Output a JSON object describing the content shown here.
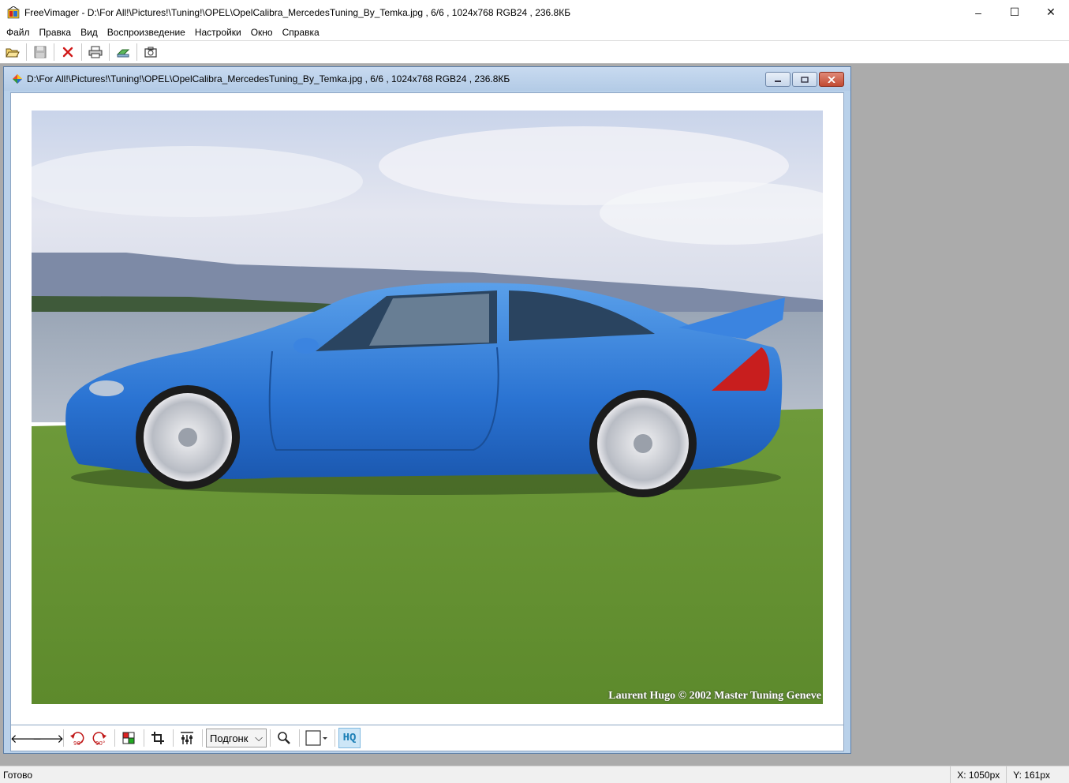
{
  "app": {
    "title": "FreeVimager - D:\\For All!\\Pictures!\\Tuning!\\OPEL\\OpelCalibra_MercedesTuning_By_Temka.jpg , 6/6 , 1024x768 RGB24 , 236.8КБ",
    "window_controls": {
      "minimize": "–",
      "maximize": "☐",
      "close": "✕"
    }
  },
  "menu": {
    "items": [
      "Файл",
      "Правка",
      "Вид",
      "Воспроизведение",
      "Настройки",
      "Окно",
      "Справка"
    ]
  },
  "toolbar": {
    "icons": [
      "open-folder-icon",
      "save-disk-icon",
      "delete-icon",
      "print-icon",
      "scan-icon",
      "camera-icon"
    ]
  },
  "child_window": {
    "title": "D:\\For All!\\Pictures!\\Tuning!\\OPEL\\OpelCalibra_MercedesTuning_By_Temka.jpg , 6/6 , 1024x768 RGB24 , 236.8КБ",
    "watermark": "Laurent Hugo © 2002  Master Tuning Geneve"
  },
  "image_toolbar": {
    "prev": "🡐",
    "next": "🡒",
    "rotate_ccw_label": "90°",
    "rotate_cw_label": "90°",
    "zoom_selected": "Подгонк",
    "zoom_arrow": "⌵",
    "hq_label": "HQ",
    "colors": {
      "accent": "#1c7fb6"
    }
  },
  "status": {
    "text": "Готово",
    "x": "X: 1050px",
    "y": "Y: 161px"
  }
}
